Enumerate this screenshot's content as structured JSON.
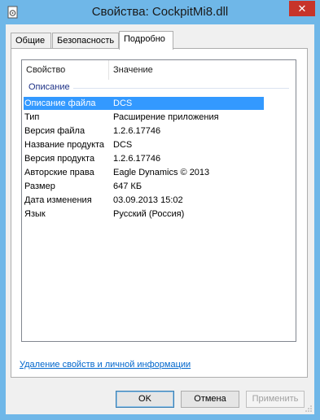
{
  "window": {
    "title": "Свойства: CockpitMi8.dll",
    "close_glyph": "✕",
    "accent": "#6fb7e8"
  },
  "tabs": [
    {
      "label": "Общие"
    },
    {
      "label": "Безопасность"
    },
    {
      "label": "Подробно"
    }
  ],
  "list": {
    "columns": {
      "property": "Свойство",
      "value": "Значение"
    },
    "group": "Описание",
    "rows": [
      {
        "property": "Описание файла",
        "value": "DCS"
      },
      {
        "property": "Тип",
        "value": "Расширение приложения"
      },
      {
        "property": "Версия файла",
        "value": "1.2.6.17746"
      },
      {
        "property": "Название продукта",
        "value": "DCS"
      },
      {
        "property": "Версия продукта",
        "value": "1.2.6.17746"
      },
      {
        "property": "Авторские права",
        "value": "Eagle Dynamics © 2013"
      },
      {
        "property": "Размер",
        "value": "647 КБ"
      },
      {
        "property": "Дата изменения",
        "value": "03.09.2013 15:02"
      },
      {
        "property": "Язык",
        "value": "Русский (Россия)"
      }
    ],
    "selected_row_color": "#3399ff"
  },
  "remove_link": "Удаление свойств и личной информации",
  "buttons": {
    "ok": "OK",
    "cancel": "Отмена",
    "apply": "Применить"
  }
}
